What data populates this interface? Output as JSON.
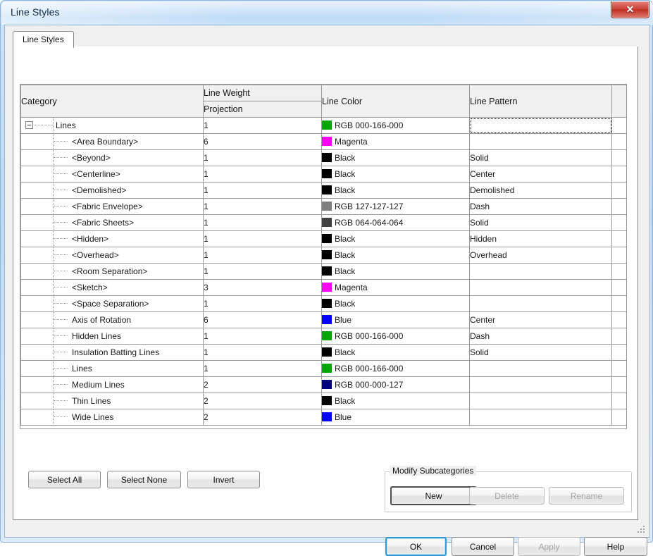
{
  "window": {
    "title": "Line Styles",
    "close_icon": "close-icon",
    "close_label": "✕"
  },
  "tabs": [
    {
      "label": "Line Styles",
      "active": true
    }
  ],
  "grid": {
    "columns": {
      "category": "Category",
      "line_weight": "Line Weight",
      "line_weight_sub": "Projection",
      "line_color": "Line Color",
      "line_pattern": "Line Pattern"
    },
    "rows": [
      {
        "category": "Lines",
        "level": "root",
        "expander": true,
        "weight": "1",
        "color_label": "RGB 000-166-000",
        "color_hex": "#00a600",
        "pattern": "",
        "focus": true
      },
      {
        "category": "<Area Boundary>",
        "level": "child",
        "expander": false,
        "weight": "6",
        "color_label": "Magenta",
        "color_hex": "#ff00ff",
        "pattern": "",
        "focus": false
      },
      {
        "category": "<Beyond>",
        "level": "child",
        "expander": false,
        "weight": "1",
        "color_label": "Black",
        "color_hex": "#000000",
        "pattern": "Solid",
        "focus": false
      },
      {
        "category": "<Centerline>",
        "level": "child",
        "expander": false,
        "weight": "1",
        "color_label": "Black",
        "color_hex": "#000000",
        "pattern": "Center",
        "focus": false
      },
      {
        "category": "<Demolished>",
        "level": "child",
        "expander": false,
        "weight": "1",
        "color_label": "Black",
        "color_hex": "#000000",
        "pattern": "Demolished",
        "focus": false
      },
      {
        "category": "<Fabric Envelope>",
        "level": "child",
        "expander": false,
        "weight": "1",
        "color_label": "RGB 127-127-127",
        "color_hex": "#7f7f7f",
        "pattern": "Dash",
        "focus": false
      },
      {
        "category": "<Fabric Sheets>",
        "level": "child",
        "expander": false,
        "weight": "1",
        "color_label": "RGB 064-064-064",
        "color_hex": "#404040",
        "pattern": "Solid",
        "focus": false
      },
      {
        "category": "<Hidden>",
        "level": "child",
        "expander": false,
        "weight": "1",
        "color_label": "Black",
        "color_hex": "#000000",
        "pattern": "Hidden",
        "focus": false
      },
      {
        "category": "<Overhead>",
        "level": "child",
        "expander": false,
        "weight": "1",
        "color_label": "Black",
        "color_hex": "#000000",
        "pattern": "Overhead",
        "focus": false
      },
      {
        "category": "<Room Separation>",
        "level": "child",
        "expander": false,
        "weight": "1",
        "color_label": "Black",
        "color_hex": "#000000",
        "pattern": "",
        "focus": false
      },
      {
        "category": "<Sketch>",
        "level": "child",
        "expander": false,
        "weight": "3",
        "color_label": "Magenta",
        "color_hex": "#ff00ff",
        "pattern": "",
        "focus": false
      },
      {
        "category": "<Space Separation>",
        "level": "child",
        "expander": false,
        "weight": "1",
        "color_label": "Black",
        "color_hex": "#000000",
        "pattern": "",
        "focus": false
      },
      {
        "category": "Axis of Rotation",
        "level": "child",
        "expander": false,
        "weight": "6",
        "color_label": "Blue",
        "color_hex": "#0000ff",
        "pattern": "Center",
        "focus": false
      },
      {
        "category": "Hidden Lines",
        "level": "child",
        "expander": false,
        "weight": "1",
        "color_label": "RGB 000-166-000",
        "color_hex": "#00a600",
        "pattern": "Dash",
        "focus": false
      },
      {
        "category": "Insulation Batting Lines",
        "level": "child",
        "expander": false,
        "weight": "1",
        "color_label": "Black",
        "color_hex": "#000000",
        "pattern": "Solid",
        "focus": false
      },
      {
        "category": "Lines",
        "level": "child",
        "expander": false,
        "weight": "1",
        "color_label": "RGB 000-166-000",
        "color_hex": "#00a600",
        "pattern": "",
        "focus": false
      },
      {
        "category": "Medium Lines",
        "level": "child",
        "expander": false,
        "weight": "2",
        "color_label": "RGB 000-000-127",
        "color_hex": "#00007f",
        "pattern": "",
        "focus": false
      },
      {
        "category": "Thin Lines",
        "level": "child",
        "expander": false,
        "weight": "2",
        "color_label": "Black",
        "color_hex": "#000000",
        "pattern": "",
        "focus": false
      },
      {
        "category": "Wide Lines",
        "level": "child",
        "expander": false,
        "weight": "2",
        "color_label": "Blue",
        "color_hex": "#0000ff",
        "pattern": "",
        "focus": false
      }
    ]
  },
  "selection_buttons": {
    "select_all": "Select All",
    "select_none": "Select None",
    "invert": "Invert"
  },
  "modify_group": {
    "title": "Modify Subcategories",
    "new": "New",
    "delete": "Delete",
    "rename": "Rename"
  },
  "dialog_buttons": {
    "ok": "OK",
    "cancel": "Cancel",
    "apply": "Apply",
    "help": "Help"
  }
}
